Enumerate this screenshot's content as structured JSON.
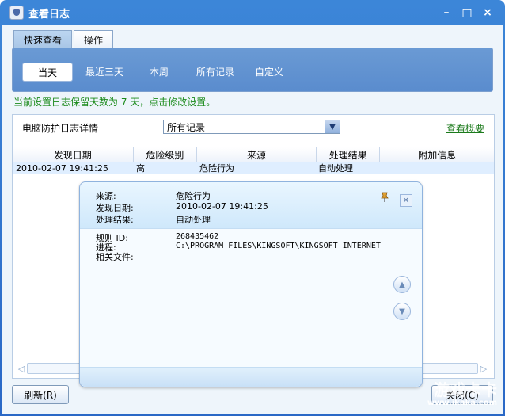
{
  "window": {
    "title": "查看日志"
  },
  "tabs": [
    {
      "label": "快速查看"
    },
    {
      "label": "操作"
    }
  ],
  "ranges": [
    {
      "label": "当天"
    },
    {
      "label": "最近三天"
    },
    {
      "label": "本周"
    },
    {
      "label": "所有记录"
    },
    {
      "label": "自定义"
    }
  ],
  "notice": "当前设置日志保留天数为 7 天，点击修改设置。",
  "panel": {
    "label": "电脑防护日志详情",
    "select_value": "所有记录",
    "summary_link": "查看概要"
  },
  "table": {
    "columns": [
      "发现日期",
      "危险级别",
      "来源",
      "处理结果",
      "附加信息"
    ],
    "rows": [
      [
        "2010-02-07 19:41:25",
        "高",
        "危险行为",
        "自动处理",
        ""
      ]
    ]
  },
  "popup": {
    "source_label": "来源:",
    "source_value": "危险行为",
    "date_label": "发现日期:",
    "date_value": "2010-02-07 19:41:25",
    "result_label": "处理结果:",
    "result_value": "自动处理",
    "rule_label": "规则 ID:",
    "rule_value": "268435462",
    "process_label": "进程:",
    "process_value": "C:\\PROGRAM FILES\\KINGSOFT\\KINGSOFT INTERNET",
    "files_label": "相关文件:"
  },
  "buttons": {
    "refresh": "刷新(R)",
    "close": "关闭(C)"
  },
  "watermark": {
    "text": "游戏卡卡",
    "url": "www.ikaka.com"
  },
  "colors": {
    "title_bar": "#3a80d4",
    "toolbar": "#5f90d0",
    "notice_text": "#1a8a1a",
    "selected_row": "#dfeeff"
  }
}
